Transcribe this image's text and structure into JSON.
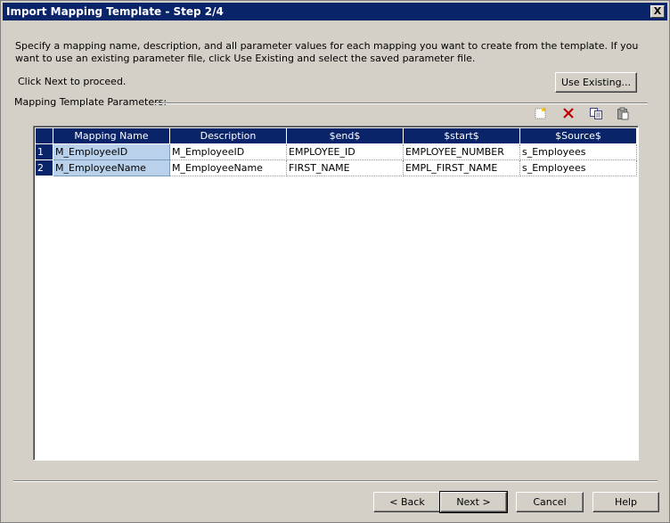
{
  "window": {
    "title": "Import Mapping Template - Step 2/4",
    "close_glyph": "X"
  },
  "instructions": {
    "line": "Specify a mapping name, description, and all parameter values for each mapping you want to create from the template. If you want to use an existing parameter file, click Use Existing and select the saved parameter file.",
    "proceed": "Click Next to proceed."
  },
  "use_existing_label": "Use Existing...",
  "group_label": "Mapping Template Parameters:",
  "toolbar": {
    "icons": [
      "new-row-icon",
      "delete-icon",
      "copy-icon",
      "paste-icon"
    ]
  },
  "grid": {
    "columns": [
      "Mapping Name",
      "Description",
      "$end$",
      "$start$",
      "$Source$"
    ],
    "rows": [
      {
        "num": "1",
        "cells": [
          "M_EmployeeID",
          "M_EmployeeID",
          "EMPLOYEE_ID",
          "EMPLOYEE_NUMBER",
          "s_Employees"
        ]
      },
      {
        "num": "2",
        "cells": [
          "M_EmployeeName",
          "M_EmployeeName",
          "FIRST_NAME",
          "EMPL_FIRST_NAME",
          "s_Employees"
        ]
      }
    ]
  },
  "footer": {
    "back": "< Back",
    "next": "Next >",
    "cancel": "Cancel",
    "help": "Help"
  },
  "colors": {
    "title_bar": "#0a246a",
    "header": "#0a246a",
    "selected_cell": "#b9d1ea",
    "dialog_bg": "#d4d0c8"
  }
}
